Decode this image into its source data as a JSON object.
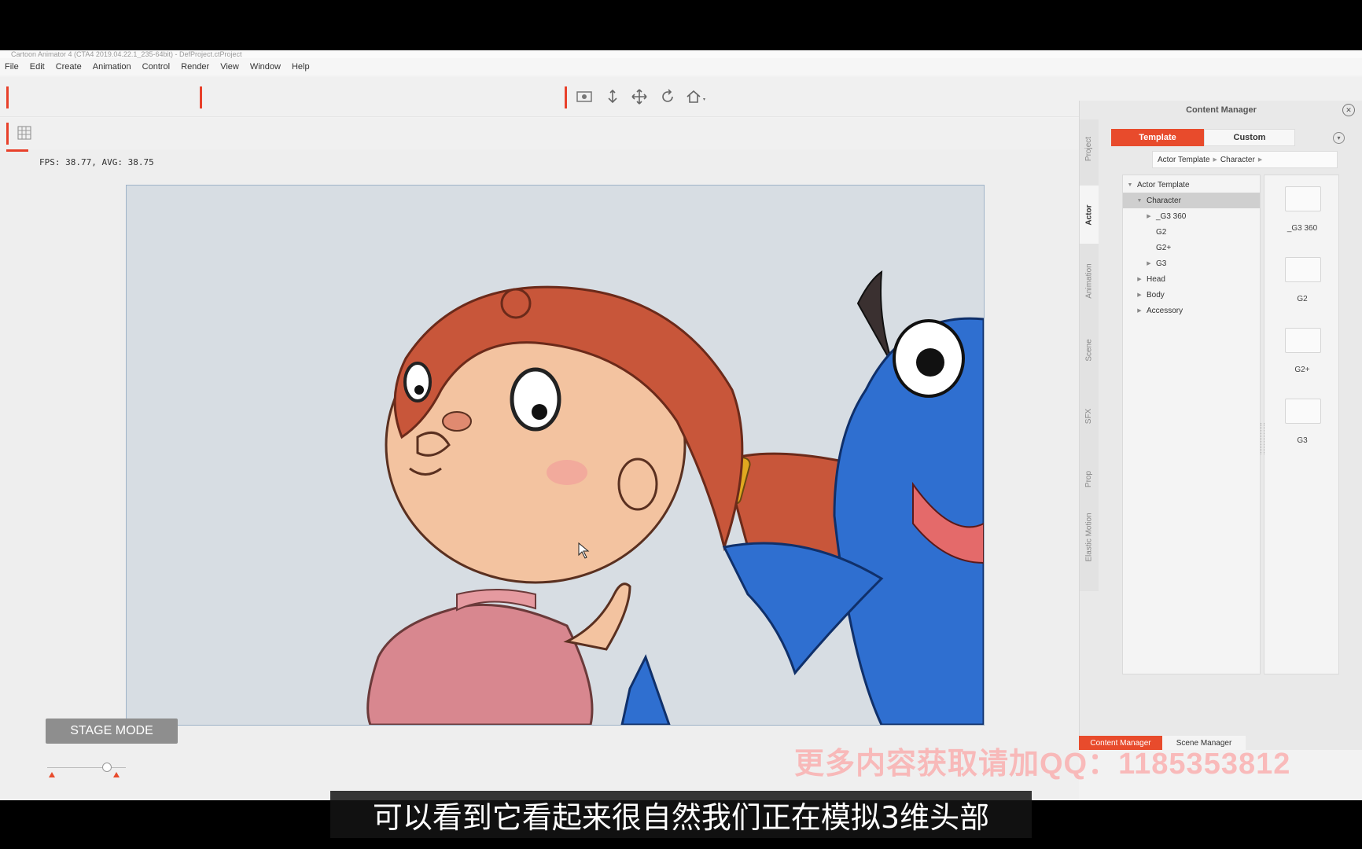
{
  "window": {
    "title": "Cartoon Animator 4 (CTA4 2019.04.22.1_235-64bit) - DefProject.ctProject"
  },
  "menu": [
    "File",
    "Edit",
    "Create",
    "Animation",
    "Control",
    "Render",
    "View",
    "Window",
    "Help"
  ],
  "stage": {
    "fps": "FPS: 38.77, AVG: 38.75",
    "mode_label": "STAGE MODE"
  },
  "content_manager": {
    "title": "Content Manager",
    "close_icon": "close-circle-icon",
    "tabs": {
      "template": "Template",
      "custom": "Custom"
    },
    "side_tabs": [
      "Project",
      "Actor",
      "Animation",
      "Scene",
      "SFX",
      "Prop",
      "Elastic Motion"
    ],
    "active_side_tab": "Actor",
    "breadcrumb": [
      "Actor Template",
      "Character"
    ],
    "tree": [
      {
        "label": "Actor Template",
        "level": 0,
        "arrow": "▼"
      },
      {
        "label": "Character",
        "level": 1,
        "arrow": "▼",
        "selected": true
      },
      {
        "label": "_G3 360",
        "level": 2,
        "arrow": "▶"
      },
      {
        "label": "G2",
        "level": 2,
        "arrow": ""
      },
      {
        "label": "G2+",
        "level": 2,
        "arrow": ""
      },
      {
        "label": "G3",
        "level": 2,
        "arrow": "▶"
      },
      {
        "label": "Head",
        "level": 1,
        "arrow": "▶"
      },
      {
        "label": "Body",
        "level": 1,
        "arrow": "▶"
      },
      {
        "label": "Accessory",
        "level": 1,
        "arrow": "▶"
      }
    ],
    "thumbnails": [
      "_G3 360",
      "G2",
      "G2+",
      "G3"
    ]
  },
  "bottom_tabs": {
    "content": "Content Manager",
    "scene": "Scene Manager"
  },
  "overlay": {
    "watermark": "更多内容获取请加QQ：1185353812",
    "subtitle": "可以看到它看起来很自然我们正在模拟3维头部"
  },
  "colors": {
    "accent": "#e84b2c",
    "hair": "#c8563a",
    "dragon": "#2f6fd0"
  }
}
